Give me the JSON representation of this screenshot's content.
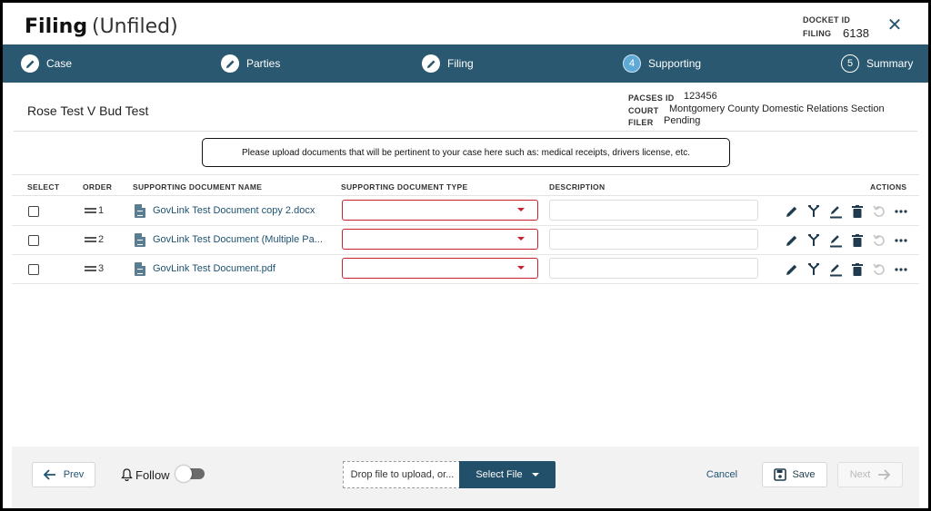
{
  "header": {
    "title": "Filing",
    "subtitle": "(Unfiled)",
    "docket_label": "DOCKET ID",
    "filing_label": "FILING",
    "filing_value": "6138"
  },
  "steps": [
    {
      "label": "Case",
      "icon": "pencil-icon"
    },
    {
      "label": "Parties",
      "icon": "pencil-icon"
    },
    {
      "label": "Filing",
      "icon": "pencil-icon"
    },
    {
      "label": "Supporting",
      "number": "4"
    },
    {
      "label": "Summary",
      "number": "5"
    }
  ],
  "case": {
    "name": "Rose Test V Bud Test",
    "pacses_label": "PACSES ID",
    "pacses_value": "123456",
    "court_label": "COURT",
    "court_value": "Montgomery County Domestic Relations Section",
    "filer_label": "FILER",
    "filer_value": "Pending"
  },
  "notice": "Please upload documents that will be pertinent to your case here such as: medical receipts, drivers license, etc.",
  "table": {
    "headers": {
      "select": "SELECT",
      "order": "ORDER",
      "name": "SUPPORTING DOCUMENT NAME",
      "type": "SUPPORTING DOCUMENT TYPE",
      "description": "DESCRIPTION",
      "actions": "ACTIONS"
    },
    "rows": [
      {
        "order": "1",
        "name": "GovLink Test Document copy 2.docx"
      },
      {
        "order": "2",
        "name": "GovLink Test Document (Multiple Pa..."
      },
      {
        "order": "3",
        "name": "GovLink Test Document.pdf"
      }
    ]
  },
  "footer": {
    "prev_label": "Prev",
    "follow_label": "Follow",
    "drop_text": "Drop file to upload, or...",
    "select_file_label": "Select File",
    "cancel_label": "Cancel",
    "save_label": "Save",
    "next_label": "Next"
  },
  "colors": {
    "steps_bar": "#295870",
    "active_step": "#5fa9d6",
    "error_border": "#c8202a",
    "primary_button": "#224f69"
  }
}
